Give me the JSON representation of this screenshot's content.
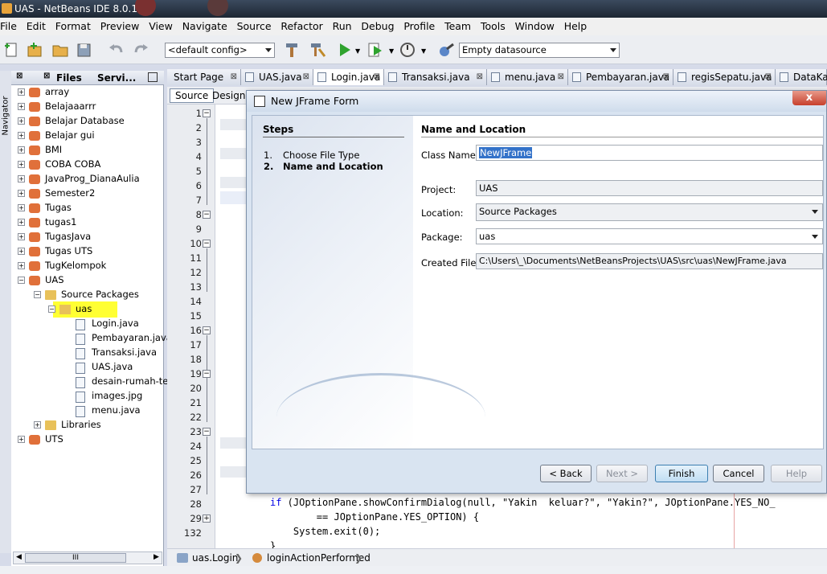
{
  "window": {
    "title": "UAS - NetBeans IDE 8.0.1"
  },
  "menu": [
    "File",
    "Edit",
    "Format",
    "Preview",
    "View",
    "Navigate",
    "Source",
    "Refactor",
    "Run",
    "Debug",
    "Profile",
    "Team",
    "Tools",
    "Window",
    "Help"
  ],
  "toolbar": {
    "config": "<default config>",
    "datasource": "Empty datasource"
  },
  "side": {
    "navigator": "Navigator"
  },
  "projects_panel": {
    "tab_files": "Files",
    "tab_services": "Servi...",
    "scroll_thumb": "III"
  },
  "tree": {
    "projects": [
      "array",
      "Belajaaarrr",
      "Belajar Database",
      "Belajar gui",
      "BMI",
      "COBA COBA",
      "JavaProg_DianaAulia",
      "Semester2",
      "Tugas",
      "tugas1",
      "TugasJava",
      "Tugas UTS",
      "TugKelompok",
      "UAS"
    ],
    "source_packages": "Source Packages",
    "package": "uas",
    "files": [
      "Login.java",
      "Pembayaran.java",
      "Transaksi.java",
      "UAS.java",
      "desain-rumah-terb",
      "images.jpg",
      "menu.java"
    ],
    "libraries": "Libraries",
    "last": "UTS"
  },
  "tabs": [
    "Start Page",
    "UAS.java",
    "Login.java",
    "Transaksi.java",
    "menu.java",
    "Pembayaran.java",
    "regisSepatu.java",
    "DataKar"
  ],
  "editor": {
    "source_btn": "Source",
    "design_btn": "Design",
    "line_numbers": [
      "1",
      "2",
      "3",
      "4",
      "5",
      "6",
      "7",
      "8",
      "9",
      "10",
      "11",
      "12",
      "13",
      "14",
      "15",
      "16",
      "17",
      "18",
      "19",
      "20",
      "21",
      "22",
      "23",
      "24",
      "25",
      "26",
      "27",
      "28",
      "29",
      "132"
    ],
    "code_line_28": "if (JOptionPane.showConfirmDialog(null, \"Yakin  keluar?\", \"Yakin?\", JOptionPane.YES_NO_",
    "code_line_29": "        == JOptionPane.YES_OPTION) {",
    "code_line_30": "    System.exit(0);",
    "code_line_31": "}"
  },
  "breadcrumb": {
    "class": "uas.Login",
    "method": "loginActionPerformed"
  },
  "dialog": {
    "title": "New JFrame Form",
    "steps_heading": "Steps",
    "steps": [
      {
        "num": "1.",
        "label": "Choose File Type"
      },
      {
        "num": "2.",
        "label": "Name and Location"
      }
    ],
    "section": "Name and Location",
    "class_name_label": "Class Name:",
    "class_name_value": "NewJFrame",
    "project_label": "Project:",
    "project_value": "UAS",
    "location_label": "Location:",
    "location_value": "Source Packages",
    "package_label": "Package:",
    "package_value": "uas",
    "created_label": "Created File:",
    "created_value": "C:\\Users\\_\\Documents\\NetBeansProjects\\UAS\\src\\uas\\NewJFrame.java",
    "buttons": {
      "back": "< Back",
      "next": "Next >",
      "finish": "Finish",
      "cancel": "Cancel",
      "help": "Help"
    }
  }
}
